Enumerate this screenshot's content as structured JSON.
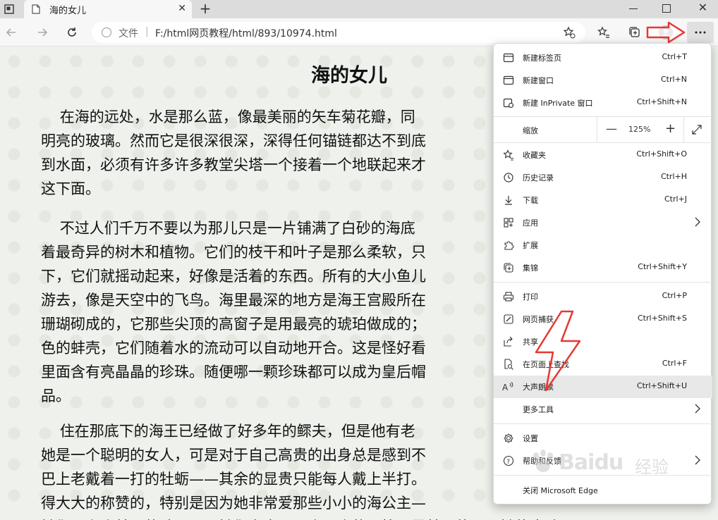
{
  "tab": {
    "title": "海的女儿",
    "close": "✕",
    "new_tab": "+"
  },
  "window": {
    "close": "✕"
  },
  "address_bar": {
    "scheme": "文件",
    "separator": "|",
    "url": "F:/html网页教程/html/893/10974.html"
  },
  "article": {
    "title": "海的女儿",
    "paragraphs": [
      "    在海的远处，水是那么蓝，像最美丽的矢车菊花瓣，同\n明亮的玻璃。然而它是很深很深，深得任何锚链都达不到底\n到水面，必须有许多许多教堂尖塔一个接着一个地联起来才\n这下面。",
      "    不过人们千万不要以为那儿只是一片铺满了白砂的海底\n着最奇异的树木和植物。它们的枝干和叶子是那么柔软，只\n下，它们就摇动起来，好像是活着的东西。所有的大小鱼儿\n游去，像是天空中的飞鸟。海里最深的地方是海王宫殿所在\n珊瑚砌成的，它那些尖顶的高窗子是用最亮的琥珀做成的；\n色的蚌壳，它们随着水的流动可以自动地开合。这是怪好看\n里面含有亮晶晶的珍珠。随便哪一颗珍珠都可以成为皇后帽\n品。",
      "    住在那底下的海王已经做了好多年的鳏夫，但是他有老\n她是一个聪明的女人，可是对于自己高贵的出身总是感到不\n巴上老戴着一打的牡蛎——其余的显贵只能每人戴上半打。\n得大大的称赞的，特别是因为她非常爱那些小小的海公主—\n她们是六个美丽的孩子。而她们之中，那个顶小的要算是最美丽的了。她的皮肤"
    ]
  },
  "menu": {
    "items": [
      {
        "label": "新建标签页",
        "shortcut": "Ctrl+T",
        "icon": "new-tab-icon"
      },
      {
        "label": "新建窗口",
        "shortcut": "Ctrl+N",
        "icon": "new-window-icon"
      },
      {
        "label": "新建 InPrivate 窗口",
        "shortcut": "Ctrl+Shift+N",
        "icon": "inprivate-icon"
      },
      {
        "label": "收藏夹",
        "shortcut": "Ctrl+Shift+O",
        "icon": "star-icon"
      },
      {
        "label": "历史记录",
        "shortcut": "Ctrl+H",
        "icon": "history-icon"
      },
      {
        "label": "下载",
        "shortcut": "Ctrl+J",
        "icon": "download-icon"
      },
      {
        "label": "应用",
        "shortcut": "",
        "icon": "apps-icon"
      },
      {
        "label": "扩展",
        "shortcut": "",
        "icon": "extensions-icon"
      },
      {
        "label": "集锦",
        "shortcut": "Ctrl+Shift+Y",
        "icon": "collections-icon"
      },
      {
        "label": "打印",
        "shortcut": "Ctrl+P",
        "icon": "print-icon"
      },
      {
        "label": "网页捕获",
        "shortcut": "Ctrl+Shift+S",
        "icon": "web-capture-icon"
      },
      {
        "label": "共享",
        "shortcut": "",
        "icon": "share-icon"
      },
      {
        "label": "在页面上查找",
        "shortcut": "Ctrl+F",
        "icon": "find-icon"
      },
      {
        "label": "大声朗读",
        "shortcut": "Ctrl+Shift+U",
        "icon": "read-aloud-icon"
      },
      {
        "label": "更多工具",
        "shortcut": "",
        "icon": ""
      },
      {
        "label": "设置",
        "shortcut": "",
        "icon": "settings-icon"
      },
      {
        "label": "帮助和反馈",
        "shortcut": "",
        "icon": "help-icon"
      },
      {
        "label": "关闭 Microsoft Edge",
        "shortcut": "",
        "icon": ""
      }
    ],
    "zoom": {
      "label": "缩放",
      "minus": "—",
      "value": "125%",
      "plus": "+"
    }
  },
  "watermark": {
    "brand": "Baidu",
    "sub": "经验"
  },
  "colors": {
    "highlight": "#e8e8e8",
    "annotation_red": "#e53935"
  }
}
